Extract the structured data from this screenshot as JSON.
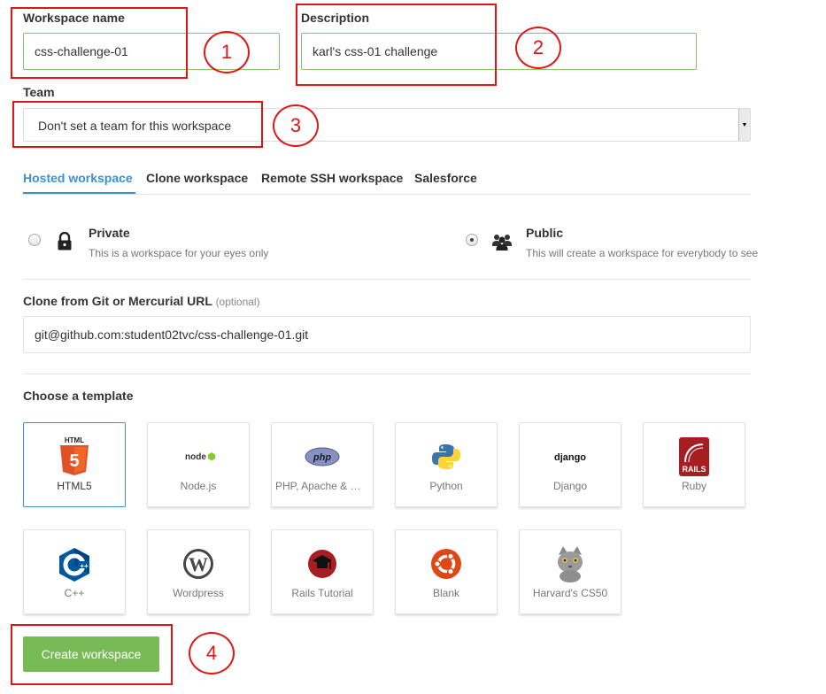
{
  "form": {
    "workspace_name_label": "Workspace name",
    "workspace_name_value": "css-challenge-01",
    "description_label": "Description",
    "description_value": "karl's css-01 challenge",
    "team_label": "Team",
    "team_value": "Don't set a team for this workspace"
  },
  "tabs": [
    {
      "label": "Hosted workspace",
      "active": true
    },
    {
      "label": "Clone workspace",
      "active": false
    },
    {
      "label": "Remote SSH workspace",
      "active": false
    },
    {
      "label": "Salesforce",
      "active": false
    }
  ],
  "visibility": {
    "private": {
      "title": "Private",
      "desc": "This is a workspace for your eyes only",
      "icon": "lock-icon",
      "checked": false
    },
    "public": {
      "title": "Public",
      "desc": "This will create a workspace for everybody to see",
      "icon": "users-icon",
      "checked": true
    }
  },
  "clone": {
    "label": "Clone from Git or Mercurial URL",
    "optional": "(optional)",
    "value": "git@github.com:student02tvc/css-challenge-01.git"
  },
  "templates": {
    "label": "Choose a template",
    "items": [
      {
        "name": "HTML5",
        "icon": "html5-icon",
        "selected": true
      },
      {
        "name": "Node.js",
        "icon": "nodejs-icon",
        "selected": false
      },
      {
        "name": "PHP, Apache & MySQL",
        "icon": "php-icon",
        "selected": false
      },
      {
        "name": "Python",
        "icon": "python-icon",
        "selected": false
      },
      {
        "name": "Django",
        "icon": "django-icon",
        "selected": false
      },
      {
        "name": "Ruby",
        "icon": "rails-icon",
        "selected": false
      },
      {
        "name": "C++",
        "icon": "cpp-icon",
        "selected": false
      },
      {
        "name": "Wordpress",
        "icon": "wordpress-icon",
        "selected": false
      },
      {
        "name": "Rails Tutorial",
        "icon": "rails-tutorial-icon",
        "selected": false
      },
      {
        "name": "Blank",
        "icon": "ubuntu-icon",
        "selected": false
      },
      {
        "name": "Harvard's CS50",
        "icon": "cat-icon",
        "selected": false
      }
    ],
    "icon_text": {
      "html5": "HTML",
      "nodejs": "node",
      "php": "php",
      "django": "django",
      "rails": "RAILS"
    }
  },
  "create_button": "Create workspace",
  "annotations": [
    "1",
    "2",
    "3",
    "4"
  ],
  "colors": {
    "accent": "#3a8fd5",
    "input_border": "#88c46a",
    "create_button": "#78bb56",
    "annotation_red": "#e01616"
  }
}
